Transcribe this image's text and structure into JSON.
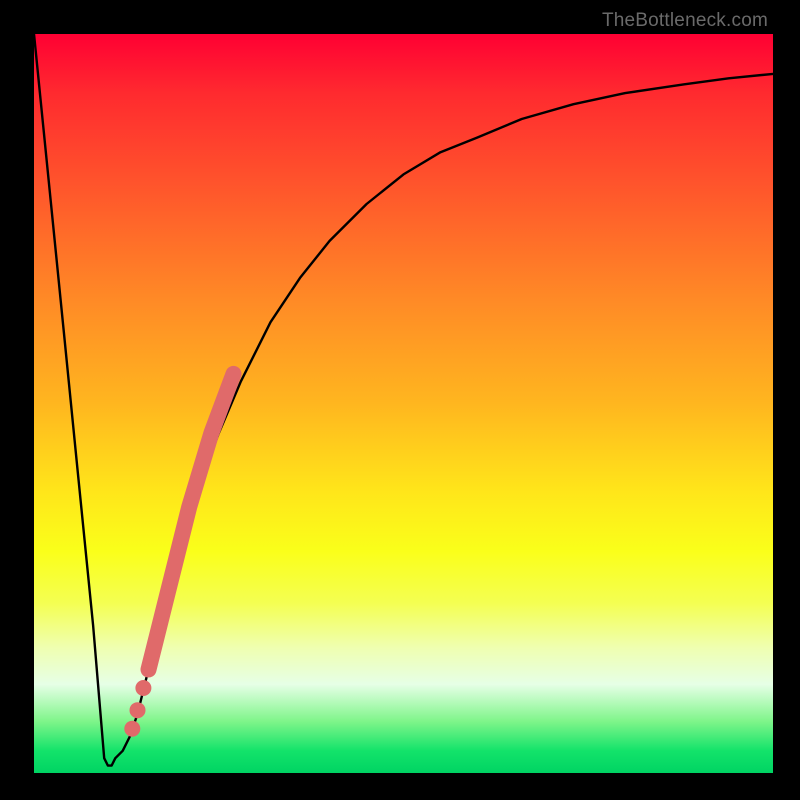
{
  "watermark": "TheBottleneck.com",
  "colors": {
    "curve": "#000000",
    "highlight": "#e06a6a",
    "background_frame": "#000000"
  },
  "chart_data": {
    "type": "line",
    "title": "",
    "xlabel": "",
    "ylabel": "",
    "xlim": [
      0,
      100
    ],
    "ylim": [
      0,
      100
    ],
    "grid": false,
    "series": [
      {
        "name": "bottleneck-curve",
        "x": [
          0,
          2,
          4,
          6,
          8,
          9,
          9.5,
          10,
          10.5,
          11,
          12,
          13,
          14,
          15,
          17,
          19,
          22,
          25,
          28,
          32,
          36,
          40,
          45,
          50,
          55,
          60,
          66,
          73,
          80,
          88,
          94,
          100
        ],
        "y": [
          100,
          80,
          60,
          40,
          20,
          8,
          2,
          1,
          1,
          2,
          3,
          5,
          8,
          12,
          20,
          28,
          38,
          46,
          53,
          61,
          67,
          72,
          77,
          81,
          84,
          86,
          88.5,
          90.5,
          92,
          93.2,
          94,
          94.6
        ]
      }
    ],
    "highlight_segment": {
      "name": "emphasis-band",
      "x": [
        15.5,
        16.5,
        18,
        19.5,
        21,
        22.5,
        24,
        25.5,
        27
      ],
      "y": [
        14,
        18,
        24,
        30,
        36,
        41,
        46,
        50,
        54
      ]
    },
    "highlight_dots": {
      "name": "emphasis-dots",
      "points": [
        {
          "x": 14.8,
          "y": 11.5
        },
        {
          "x": 14.0,
          "y": 8.5
        },
        {
          "x": 13.3,
          "y": 6.0
        }
      ]
    },
    "gradient_stops": [
      {
        "pos": 0,
        "color": "#ff0033"
      },
      {
        "pos": 50,
        "color": "#ffe61a"
      },
      {
        "pos": 88,
        "color": "#e6ffe6"
      },
      {
        "pos": 100,
        "color": "#00d463"
      }
    ]
  }
}
